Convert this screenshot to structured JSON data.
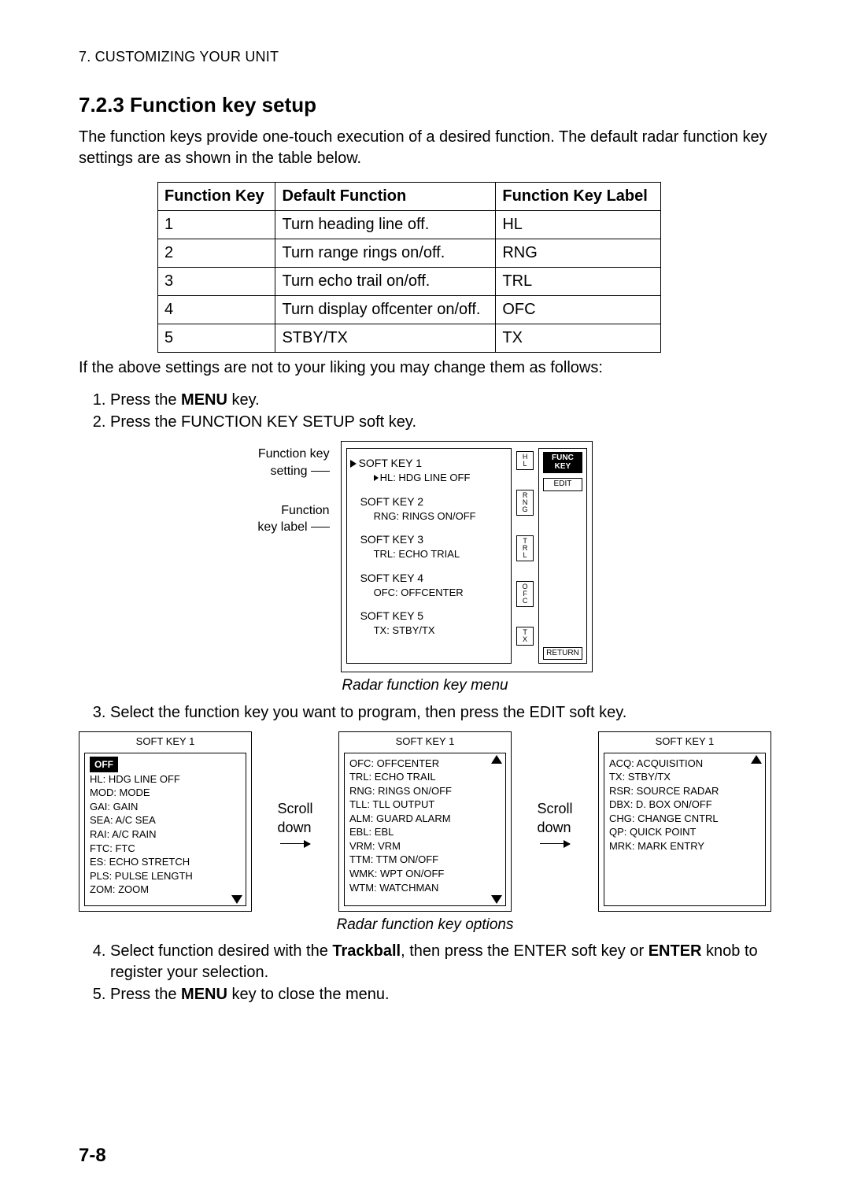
{
  "running_head": "7. CUSTOMIZING YOUR UNIT",
  "heading": "7.2.3   Function key setup",
  "intro": "The function keys provide one-touch execution of a desired function. The default radar function key settings are as shown in the table below.",
  "table": {
    "headers": [
      "Function Key",
      "Default Function",
      "Function Key Label"
    ],
    "rows": [
      [
        "1",
        "Turn heading line off.",
        "HL"
      ],
      [
        "2",
        "Turn range rings on/off.",
        "RNG"
      ],
      [
        "3",
        "Turn echo trail on/off.",
        "TRL"
      ],
      [
        "4",
        "Turn display offcenter on/off.",
        "OFC"
      ],
      [
        "5",
        "STBY/TX",
        "TX"
      ]
    ]
  },
  "after_table": "If the above settings are not to your liking you may change them as follows:",
  "steps": {
    "s1_a": "Press the ",
    "s1_b": "MENU",
    "s1_c": " key.",
    "s2": "Press the FUNCTION KEY SETUP soft key.",
    "s3": "Select the function key you want to program, then press the EDIT soft key.",
    "s4_a": "Select function desired with the ",
    "s4_b": "Trackball",
    "s4_c": ", then press the ENTER soft key or ",
    "s4_d": "ENTER",
    "s4_e": " knob to register your selection.",
    "s5_a": "Press the ",
    "s5_b": "MENU",
    "s5_c": " key to close the menu."
  },
  "menu": {
    "label_setting": "Function key\nsetting",
    "label_keylabel": "Function\nkey label",
    "items": [
      {
        "title": "SOFT KEY 1",
        "sub": "HL: HDG LINE OFF",
        "badge": "HL"
      },
      {
        "title": "SOFT KEY 2",
        "sub": "RNG: RINGS ON/OFF",
        "badge": "RNG"
      },
      {
        "title": "SOFT KEY 3",
        "sub": "TRL: ECHO TRIAL",
        "badge": "TRL"
      },
      {
        "title": "SOFT KEY 4",
        "sub": "OFC: OFFCENTER",
        "badge": "OFC"
      },
      {
        "title": "SOFT KEY 5",
        "sub": "TX: STBY/TX",
        "badge": "TX"
      }
    ],
    "side": {
      "top": "FUNC\nKEY",
      "edit": "EDIT",
      "return": "RETURN"
    },
    "caption": "Radar function key menu"
  },
  "options": {
    "scroll": "Scroll\ndown",
    "title": "SOFT KEY 1",
    "off": "OFF",
    "col1": [
      "HL: HDG LINE OFF",
      "MOD: MODE",
      "GAI: GAIN",
      "SEA: A/C SEA",
      "RAI: A/C RAIN",
      "FTC: FTC",
      "ES: ECHO STRETCH",
      "PLS: PULSE LENGTH",
      "ZOM: ZOOM"
    ],
    "col2": [
      "OFC: OFFCENTER",
      "TRL: ECHO TRAIL",
      "RNG: RINGS ON/OFF",
      "TLL: TLL OUTPUT",
      "ALM: GUARD ALARM",
      "EBL: EBL",
      "VRM: VRM",
      "TTM: TTM ON/OFF",
      "WMK: WPT ON/OFF",
      "WTM: WATCHMAN"
    ],
    "col3": [
      "ACQ: ACQUISITION",
      "TX: STBY/TX",
      "RSR: SOURCE RADAR",
      "DBX: D. BOX ON/OFF",
      "CHG: CHANGE CNTRL",
      "QP: QUICK POINT",
      "MRK: MARK ENTRY"
    ],
    "caption": "Radar function key options"
  },
  "page_num": "7-8"
}
